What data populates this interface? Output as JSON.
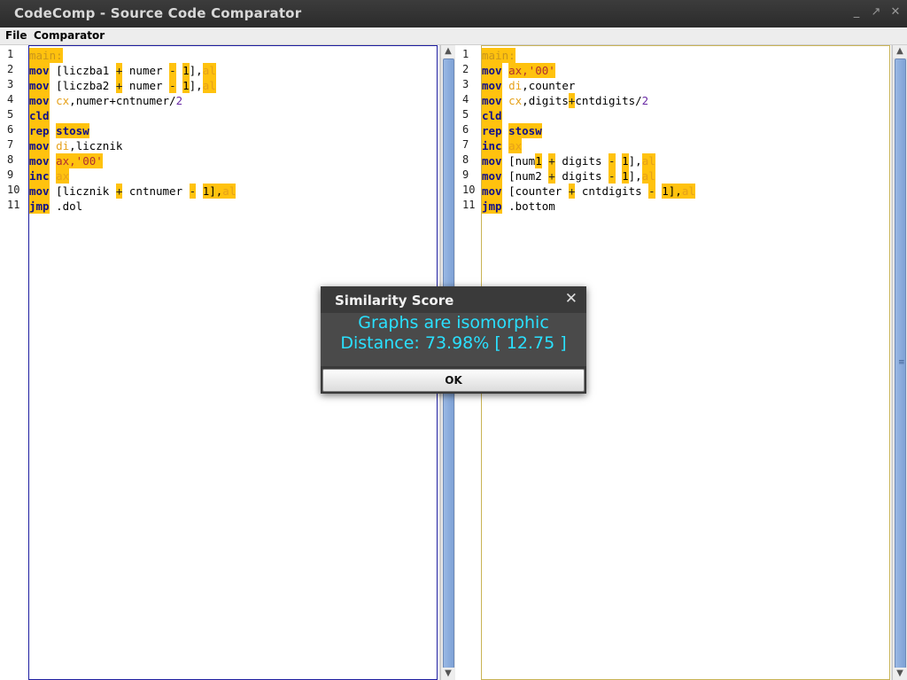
{
  "window": {
    "title": "CodeComp - Source Code Comparator",
    "controls": {
      "minimize": "_",
      "maximize": "↗",
      "close": "✕"
    }
  },
  "menu": {
    "items": [
      "File",
      "Comparator"
    ]
  },
  "left_editor": {
    "line_numbers": [
      "1",
      "2",
      "3",
      "4",
      "5",
      "6",
      "7",
      "8",
      "9",
      "10",
      "11"
    ],
    "lines": [
      [
        {
          "t": "main:",
          "c": "lbl",
          "h": true
        }
      ],
      [
        {
          "t": "mov",
          "c": "kw",
          "h": true
        },
        {
          "t": " [liczba1 ",
          "c": "pl"
        },
        {
          "t": "+",
          "c": "op",
          "h": true
        },
        {
          "t": " numer ",
          "c": "pl"
        },
        {
          "t": "-",
          "c": "op",
          "h": true
        },
        {
          "t": " ",
          "c": "pl"
        },
        {
          "t": "1",
          "c": "pl",
          "h": true
        },
        {
          "t": "],",
          "c": "pl"
        },
        {
          "t": "al",
          "c": "reg",
          "h": true
        }
      ],
      [
        {
          "t": "mov",
          "c": "kw",
          "h": true
        },
        {
          "t": " [liczba2 ",
          "c": "pl"
        },
        {
          "t": "+",
          "c": "op",
          "h": true
        },
        {
          "t": " numer ",
          "c": "pl"
        },
        {
          "t": "-",
          "c": "op",
          "h": true
        },
        {
          "t": " ",
          "c": "pl"
        },
        {
          "t": "1",
          "c": "pl",
          "h": true
        },
        {
          "t": "],",
          "c": "pl"
        },
        {
          "t": "al",
          "c": "reg",
          "h": true
        }
      ],
      [
        {
          "t": "mov",
          "c": "kw",
          "h": true
        },
        {
          "t": " ",
          "c": "pl"
        },
        {
          "t": "cx",
          "c": "reg"
        },
        {
          "t": ",numer+cntnumer/",
          "c": "pl"
        },
        {
          "t": "2",
          "c": "num"
        }
      ],
      [
        {
          "t": "cld",
          "c": "kw",
          "h": true
        }
      ],
      [
        {
          "t": "rep",
          "c": "kw",
          "h": true
        },
        {
          "t": " ",
          "c": "pl"
        },
        {
          "t": "stosw",
          "c": "kw",
          "h": true
        }
      ],
      [
        {
          "t": "mov",
          "c": "kw",
          "h": true
        },
        {
          "t": " ",
          "c": "pl"
        },
        {
          "t": "di",
          "c": "reg"
        },
        {
          "t": ",licznik",
          "c": "pl"
        }
      ],
      [
        {
          "t": "mov",
          "c": "kw",
          "h": true
        },
        {
          "t": " ",
          "c": "pl"
        },
        {
          "t": "ax,'00'",
          "c": "str",
          "h": true
        }
      ],
      [
        {
          "t": "inc",
          "c": "kw",
          "h": true
        },
        {
          "t": " ",
          "c": "pl"
        },
        {
          "t": "ax",
          "c": "reg",
          "h": true
        }
      ],
      [
        {
          "t": "mov",
          "c": "kw",
          "h": true
        },
        {
          "t": " [licznik ",
          "c": "pl"
        },
        {
          "t": "+",
          "c": "op",
          "h": true
        },
        {
          "t": " cntnumer ",
          "c": "pl"
        },
        {
          "t": "-",
          "c": "op",
          "h": true
        },
        {
          "t": " ",
          "c": "pl"
        },
        {
          "t": "1",
          "c": "pl",
          "h": true
        },
        {
          "t": "],",
          "c": "pl",
          "h": true
        },
        {
          "t": "al",
          "c": "reg",
          "h": true
        }
      ],
      [
        {
          "t": "jmp",
          "c": "kw",
          "h": true
        },
        {
          "t": " .dol",
          "c": "pl"
        }
      ]
    ]
  },
  "right_editor": {
    "line_numbers": [
      "1",
      "2",
      "3",
      "4",
      "5",
      "6",
      "7",
      "8",
      "9",
      "10",
      "11"
    ],
    "lines": [
      [
        {
          "t": "main:",
          "c": "lbl",
          "h": true
        }
      ],
      [
        {
          "t": "mov",
          "c": "kw",
          "h": true
        },
        {
          "t": " ",
          "c": "pl"
        },
        {
          "t": "ax,'00'",
          "c": "str",
          "h": true
        }
      ],
      [
        {
          "t": "mov",
          "c": "kw",
          "h": true
        },
        {
          "t": " ",
          "c": "pl"
        },
        {
          "t": "di",
          "c": "reg"
        },
        {
          "t": ",counter",
          "c": "pl"
        }
      ],
      [
        {
          "t": "mov",
          "c": "kw",
          "h": true
        },
        {
          "t": " ",
          "c": "pl"
        },
        {
          "t": "cx",
          "c": "reg"
        },
        {
          "t": ",digits",
          "c": "pl"
        },
        {
          "t": "+",
          "c": "op",
          "h": true
        },
        {
          "t": "cntdigits/",
          "c": "pl"
        },
        {
          "t": "2",
          "c": "num"
        }
      ],
      [
        {
          "t": "cld",
          "c": "kw",
          "h": true
        }
      ],
      [
        {
          "t": "rep",
          "c": "kw",
          "h": true
        },
        {
          "t": " ",
          "c": "pl"
        },
        {
          "t": "stosw",
          "c": "kw",
          "h": true
        }
      ],
      [
        {
          "t": "inc",
          "c": "kw",
          "h": true
        },
        {
          "t": " ",
          "c": "pl"
        },
        {
          "t": "ax",
          "c": "reg",
          "h": true
        }
      ],
      [
        {
          "t": "mov",
          "c": "kw",
          "h": true
        },
        {
          "t": " [num",
          "c": "pl"
        },
        {
          "t": "1",
          "c": "pl",
          "h": true
        },
        {
          "t": " ",
          "c": "pl"
        },
        {
          "t": "+",
          "c": "op",
          "h": true
        },
        {
          "t": " digits ",
          "c": "pl"
        },
        {
          "t": "-",
          "c": "op",
          "h": true
        },
        {
          "t": " ",
          "c": "pl"
        },
        {
          "t": "1",
          "c": "pl",
          "h": true
        },
        {
          "t": "],",
          "c": "pl"
        },
        {
          "t": "al",
          "c": "reg",
          "h": true
        }
      ],
      [
        {
          "t": "mov",
          "c": "kw",
          "h": true
        },
        {
          "t": " [num2 ",
          "c": "pl"
        },
        {
          "t": "+",
          "c": "op",
          "h": true
        },
        {
          "t": " digits ",
          "c": "pl"
        },
        {
          "t": "-",
          "c": "op",
          "h": true
        },
        {
          "t": " ",
          "c": "pl"
        },
        {
          "t": "1",
          "c": "pl",
          "h": true
        },
        {
          "t": "],",
          "c": "pl"
        },
        {
          "t": "al",
          "c": "reg",
          "h": true
        }
      ],
      [
        {
          "t": "mov",
          "c": "kw",
          "h": true
        },
        {
          "t": " [counter ",
          "c": "pl"
        },
        {
          "t": "+",
          "c": "op",
          "h": true
        },
        {
          "t": " cntdigits ",
          "c": "pl"
        },
        {
          "t": "-",
          "c": "op",
          "h": true
        },
        {
          "t": " ",
          "c": "pl"
        },
        {
          "t": "1",
          "c": "pl",
          "h": true
        },
        {
          "t": "],",
          "c": "pl",
          "h": true
        },
        {
          "t": "al",
          "c": "reg",
          "h": true
        }
      ],
      [
        {
          "t": "jmp",
          "c": "kw",
          "h": true
        },
        {
          "t": " .bottom",
          "c": "pl"
        }
      ]
    ]
  },
  "scrollbars": {
    "up_arrow": "▲",
    "down_arrow": "▼",
    "grip": "≡"
  },
  "dialog": {
    "title": "Similarity Score",
    "close": "✕",
    "message_line1": "Graphs are isomorphic",
    "message_line2": "Distance: 73.98% [ 12.75 ]",
    "ok_label": "OK"
  },
  "colors": {
    "highlight": "#ffc20e",
    "keyword": "#10108a",
    "register": "#e6a11a",
    "message": "#2ae0ff",
    "left_border": "#1e1ea0",
    "right_border": "#c9b355"
  }
}
